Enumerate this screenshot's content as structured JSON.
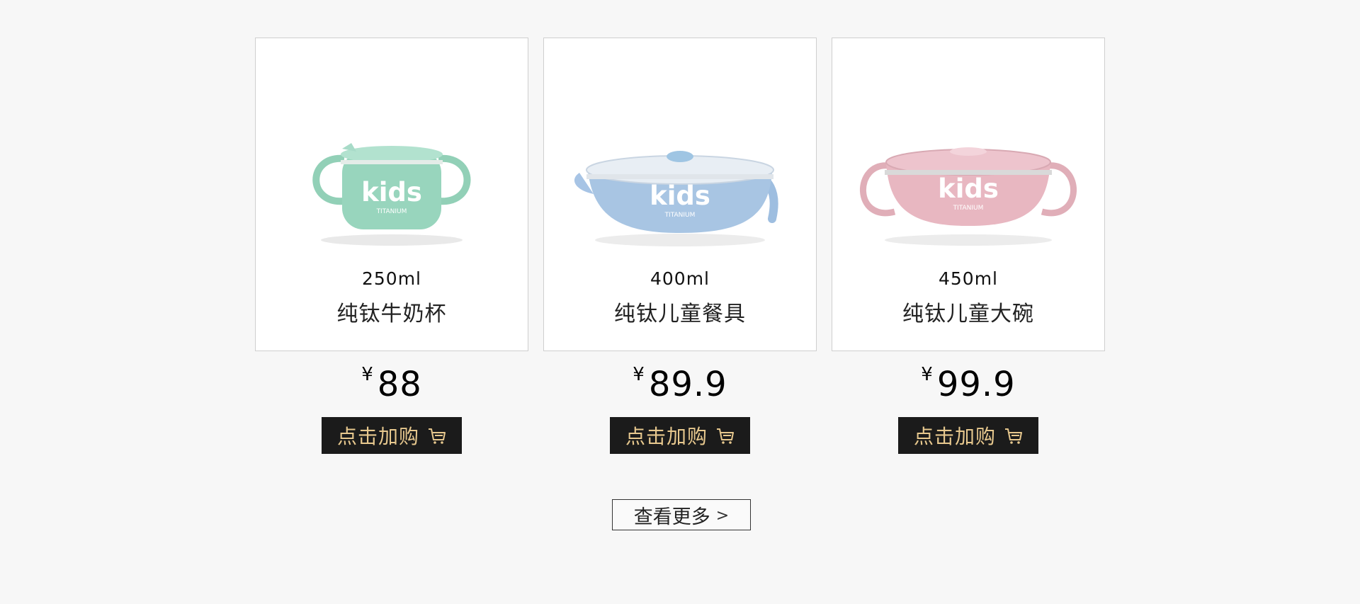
{
  "products": [
    {
      "volume": "250ml",
      "name": "纯钛牛奶杯",
      "currency": "¥",
      "price": "88",
      "buy_label": "点击加购",
      "image": {
        "label": "kids",
        "subtitle": "TITANIUM",
        "color": "#97d4bb"
      }
    },
    {
      "volume": "400ml",
      "name": "纯钛儿童餐具",
      "currency": "¥",
      "price": "89.9",
      "buy_label": "点击加购",
      "image": {
        "label": "kids",
        "subtitle": "TITANIUM",
        "color": "#a8c5e3"
      }
    },
    {
      "volume": "450ml",
      "name": "纯钛儿童大碗",
      "currency": "¥",
      "price": "99.9",
      "buy_label": "点击加购",
      "image": {
        "label": "kids",
        "subtitle": "TITANIUM",
        "color": "#e9b8c2"
      }
    }
  ],
  "view_more": {
    "label": "查看更多",
    "icon": "chevron-right-icon"
  },
  "colors": {
    "background": "#f7f7f7",
    "button_bg": "#1b1b1b",
    "button_text": "#e7c88e"
  }
}
